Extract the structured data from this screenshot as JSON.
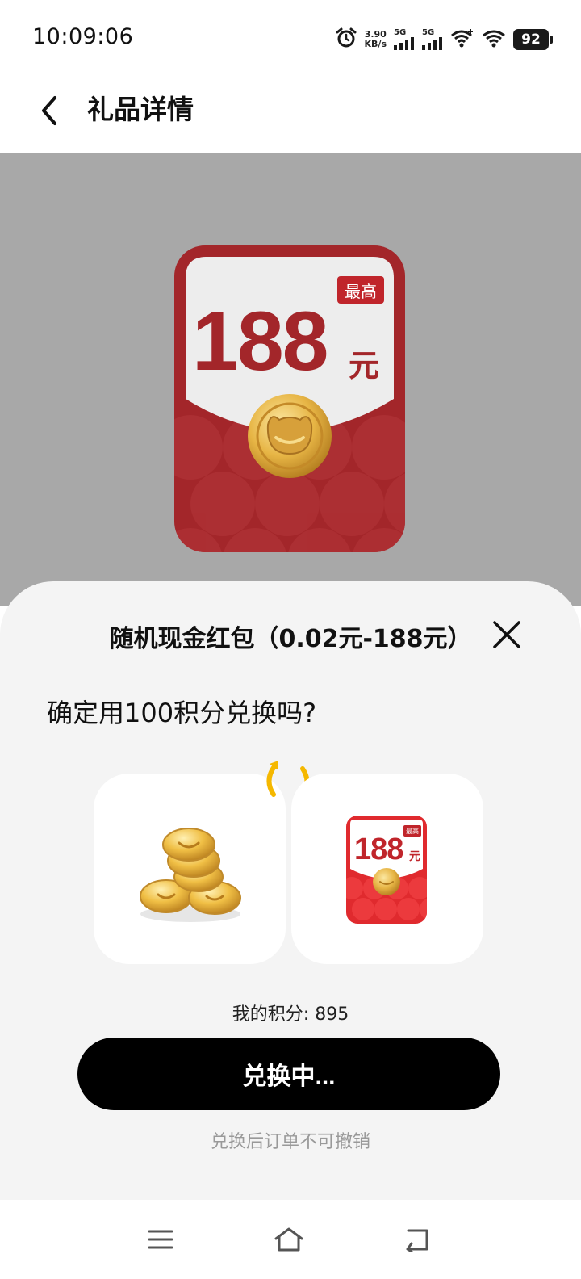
{
  "status_bar": {
    "time": "10:09:06",
    "net_speed_value": "3.90",
    "net_speed_unit": "KB/s",
    "sim1_label": "5G",
    "sim2_label": "5G",
    "battery": "92",
    "icons": [
      "alarm-icon",
      "signal-icon",
      "wifi-icon",
      "battery-icon"
    ]
  },
  "header": {
    "title": "礼品详情"
  },
  "hero": {
    "badge": "最高",
    "amount": "188",
    "unit": "元"
  },
  "sheet": {
    "title": "随机现金红包（0.02元-188元）",
    "question": "确定用100积分兑换吗?",
    "mini_badge": "最高",
    "mini_amount": "188",
    "mini_unit": "元",
    "points_label": "我的积分: 895",
    "button_label": "兑换中...",
    "footnote": "兑换后订单不可撤销"
  },
  "colors": {
    "envelope_red": "#a82a28",
    "envelope_red_light": "#e02a2e",
    "badge_red": "#c0252b",
    "gold": "#e9b33b",
    "swap_yellow": "#f5b800"
  }
}
